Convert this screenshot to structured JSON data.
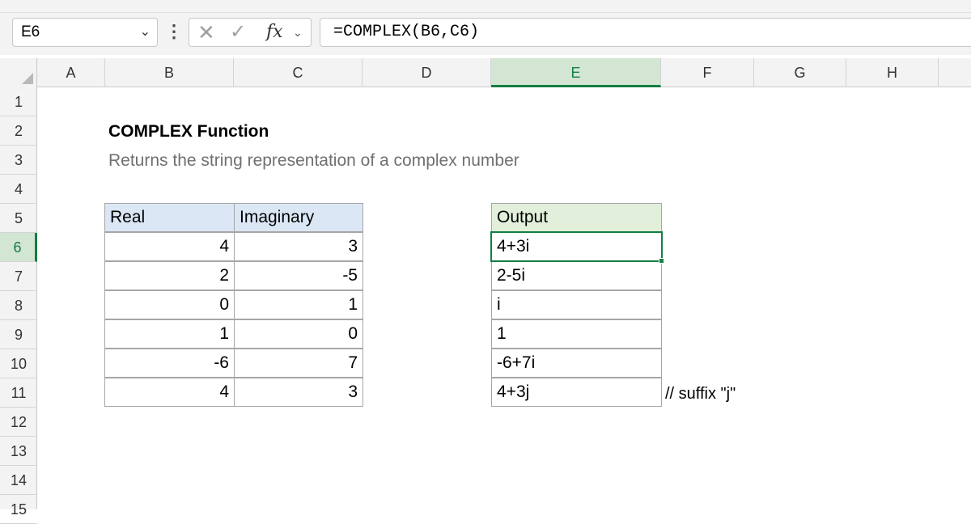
{
  "namebox": {
    "value": "E6"
  },
  "formula_bar": {
    "formula": "=COMPLEX(B6,C6)",
    "fx_label": "fx"
  },
  "columns": [
    "A",
    "B",
    "C",
    "D",
    "E",
    "F",
    "G",
    "H"
  ],
  "rows": [
    "1",
    "2",
    "3",
    "4",
    "5",
    "6",
    "7",
    "8",
    "9",
    "10",
    "11",
    "12",
    "13",
    "14",
    "15"
  ],
  "selected": {
    "column": "E",
    "row": "6"
  },
  "sheet": {
    "title": "COMPLEX Function",
    "subtitle": "Returns the string representation of a complex number",
    "table": {
      "headers": [
        "Real",
        "Imaginary"
      ],
      "rows": [
        [
          "4",
          "3"
        ],
        [
          "2",
          "-5"
        ],
        [
          "0",
          "1"
        ],
        [
          "1",
          "0"
        ],
        [
          "-6",
          "7"
        ],
        [
          "4",
          "3"
        ]
      ]
    },
    "output": {
      "header": "Output",
      "values": [
        "4+3i",
        "2-5i",
        "i",
        "1",
        "-6+7i",
        "4+3j"
      ]
    },
    "note": "// suffix \"j\""
  },
  "colors": {
    "accent": "#137e43",
    "input_header": "#dbe7f5",
    "output_header": "#e2efda"
  }
}
